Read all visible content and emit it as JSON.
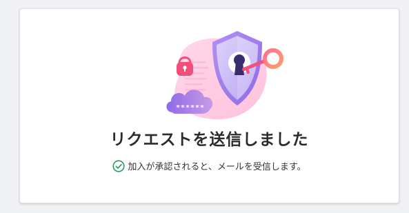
{
  "confirmation": {
    "title": "リクエストを送信しました",
    "message": "加入が承認されると、メールを受信します。",
    "icons": {
      "illustration": "security-shield-keyhole-illustration",
      "status": "check-circle-icon"
    },
    "illustration_password_mask": "******",
    "colors": {
      "success": "#2e9a5c",
      "accent": "#9b6be8",
      "pink": "#f26b9c"
    }
  }
}
